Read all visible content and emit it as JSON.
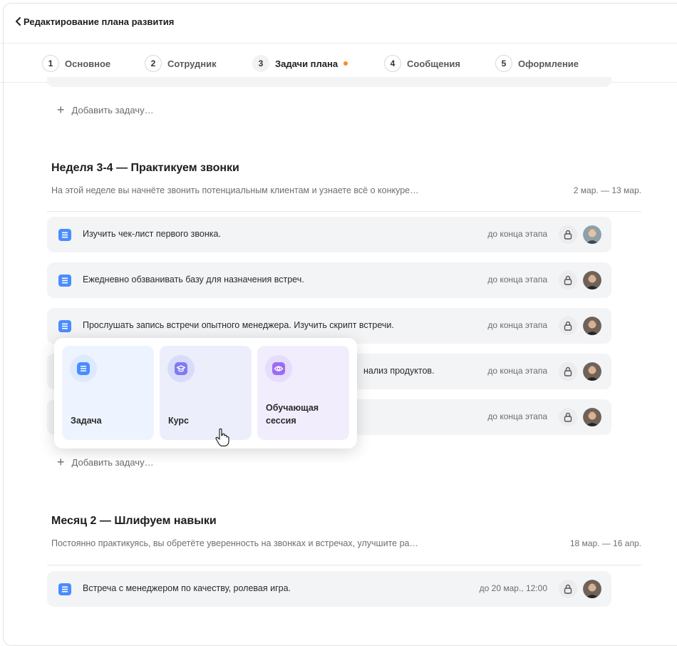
{
  "header": {
    "title": "Редактирование плана развития"
  },
  "tabs": [
    {
      "num": "1",
      "label": "Основное"
    },
    {
      "num": "2",
      "label": "Сотрудник"
    },
    {
      "num": "3",
      "label": "Задачи плана",
      "active": true,
      "has_dot": true
    },
    {
      "num": "4",
      "label": "Сообщения"
    },
    {
      "num": "5",
      "label": "Оформление"
    }
  ],
  "add_task_label": "Добавить задачу…",
  "sections": [
    {
      "title": "Неделя 3-4 — Практикуем звонки",
      "description": "На этой неделе вы начнёте звонить потенциальным клиентам и узнаете всё о конкуре…",
      "dates": "2 мар. — 13 мар.",
      "tasks": [
        {
          "label": "Изучить чек-лист первого звонка.",
          "deadline": "до конца этапа"
        },
        {
          "label": "Ежедневно обзванивать базу для назначения встреч.",
          "deadline": "до конца этапа"
        },
        {
          "label": "Прослушать запись встречи опытного менеджера. Изучить скрипт встречи.",
          "deadline": "до конца этапа"
        },
        {
          "label": "нализ продуктов.",
          "deadline": "до конца этапа"
        },
        {
          "label": "",
          "deadline": "до конца этапа"
        }
      ]
    },
    {
      "title": "Месяц 2 — Шлифуем навыки",
      "description": "Постоянно практикуясь, вы обретёте уверенность на звонках и встречах, улучшите ра…",
      "dates": "18 мар. — 16 апр.",
      "tasks": [
        {
          "label": "Встреча с менеджером по качеству, ролевая игра.",
          "deadline": "до 20 мар., 12:00"
        }
      ]
    }
  ],
  "popover": {
    "cards": [
      {
        "label": "Задача",
        "icon": "list-icon"
      },
      {
        "label": "Курс",
        "icon": "graduation-cap-icon"
      },
      {
        "label": "Обучающая сессия",
        "icon": "eye-icon"
      }
    ]
  },
  "colors": {
    "accent_green": "#2fb35f",
    "dot_orange": "#ff8a1f",
    "task_blue": "#4a8cff",
    "course_purple": "#7f7cf0",
    "session_purple": "#9b6cf2"
  }
}
